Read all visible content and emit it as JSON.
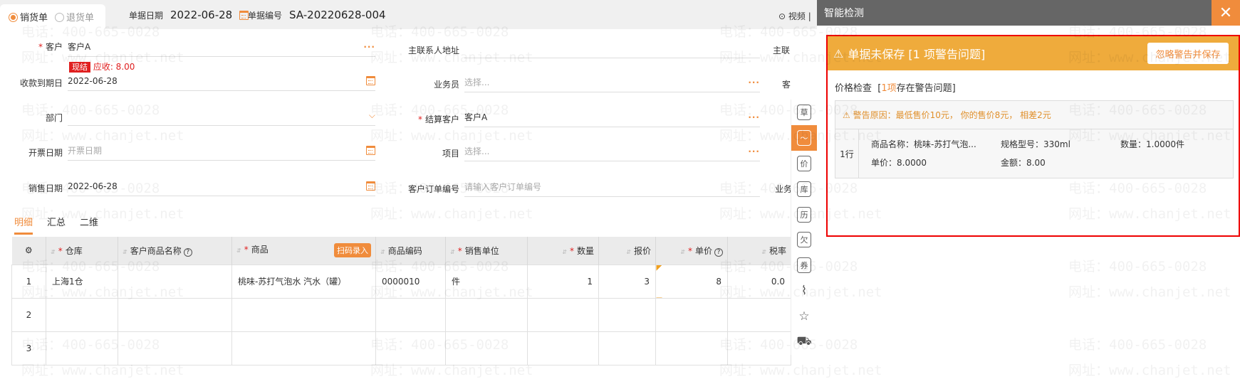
{
  "header": {
    "type_options": [
      {
        "label": "销货单",
        "selected": true
      },
      {
        "label": "退货单",
        "selected": false
      }
    ],
    "date_label": "单据日期",
    "date_value": "2022-06-28",
    "number_label": "单据编号",
    "number_value": "SA-20220628-004",
    "video_label": "视频"
  },
  "form": {
    "customer": {
      "label": "客户",
      "value": "客户A",
      "badge": "现结",
      "receivable": "应收: 8.00"
    },
    "due_date": {
      "label": "收款到期日",
      "value": "2022-06-28"
    },
    "department": {
      "label": "部门",
      "value": ""
    },
    "invoice_date": {
      "label": "开票日期",
      "placeholder": "开票日期"
    },
    "sale_date": {
      "label": "销售日期",
      "value": "2022-06-28"
    },
    "contact_address": {
      "label": "主联系人地址",
      "value": ""
    },
    "salesperson": {
      "label": "业务员",
      "placeholder": "选择..."
    },
    "settle_customer": {
      "label": "结算客户",
      "value": "客户A"
    },
    "project": {
      "label": "项目",
      "placeholder": "选择..."
    },
    "customer_order": {
      "label": "客户订单编号",
      "placeholder": "请输入客户订单编号"
    },
    "col3_labels": [
      "主联系",
      "客",
      "业务"
    ]
  },
  "tabs": [
    "明细",
    "汇总",
    "二维"
  ],
  "table": {
    "scan_button": "扫码录入",
    "columns": [
      {
        "label": "仓库",
        "req": true
      },
      {
        "label": "客户商品名称",
        "help": true
      },
      {
        "label": "商品",
        "req": true
      },
      {
        "label": "商品编码"
      },
      {
        "label": "销售单位",
        "req": true
      },
      {
        "label": "数量",
        "req": true
      },
      {
        "label": "报价"
      },
      {
        "label": "单价",
        "req": true,
        "help": true
      },
      {
        "label": "税率"
      }
    ],
    "rows": [
      {
        "no": "1",
        "cells": [
          "上海1仓",
          "",
          "桃味-苏打气泡水 汽水（罐）",
          "0000010",
          "件",
          "1",
          "3",
          "8",
          "0.0"
        ]
      },
      {
        "no": "2",
        "cells": [
          "",
          "",
          "",
          "",
          "",
          "",
          "",
          "",
          ""
        ]
      },
      {
        "no": "3",
        "cells": [
          "",
          "",
          "",
          "",
          "",
          "",
          "",
          "",
          ""
        ]
      }
    ]
  },
  "side_toolbar": [
    {
      "icon": "draft-icon",
      "label": "草"
    },
    {
      "icon": "trend-icon",
      "label": "",
      "active": true
    },
    {
      "icon": "price-icon",
      "label": "价"
    },
    {
      "icon": "stock-icon",
      "label": "库"
    },
    {
      "icon": "history-icon",
      "label": "历"
    },
    {
      "icon": "owe-icon",
      "label": "欠"
    },
    {
      "icon": "coupon-icon",
      "label": "券"
    },
    {
      "icon": "attachment-icon",
      "label": "⌇"
    },
    {
      "icon": "star-icon",
      "label": "☆"
    },
    {
      "icon": "truck-icon",
      "label": "⛟"
    }
  ],
  "panel": {
    "title": "智能检测",
    "close": "✕",
    "warning_title": "单据未保存 [1 项警告问题]",
    "ignore_button": "忽略警告并保存",
    "section_label": "价格检查",
    "section_prefix": "[",
    "section_count": "1项",
    "section_suffix": "存在警告问题]",
    "reason": "警告原因：最低售价10元， 你的售价8元， 相差2元",
    "row_no": "1行",
    "product_name": "商品名称：桃味-苏打气泡...",
    "spec": "规格型号：330ml",
    "qty": "数量：1.0000件",
    "unit_price": "单价：8.0000",
    "amount": "金额：8.00"
  },
  "watermark": {
    "phone": "电话：400-665-0028",
    "site": "网址：www.chanjet.net"
  },
  "colors": {
    "accent": "#f08c3c",
    "warning": "#efab3c",
    "error": "#e02020"
  }
}
